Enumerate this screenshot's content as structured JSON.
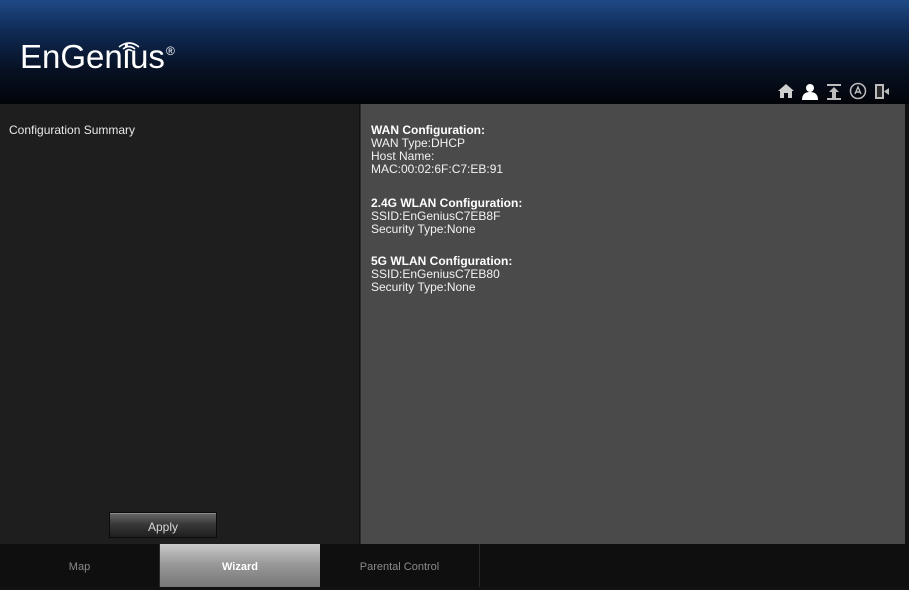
{
  "brand": {
    "name": "EnGenius",
    "reg": "®"
  },
  "toolbar": {
    "icons": [
      "home-icon",
      "user-icon",
      "upload-icon",
      "language-icon",
      "logout-icon"
    ]
  },
  "left": {
    "title": "Configuration Summary",
    "apply_label": "Apply"
  },
  "summary": {
    "wan": {
      "title": "WAN Configuration:",
      "rows": [
        "WAN Type:DHCP",
        "Host Name:",
        "MAC:00:02:6F:C7:EB:91"
      ]
    },
    "wlan24": {
      "title": "2.4G WLAN Configuration:",
      "rows": [
        "SSID:EnGeniusC7EB8F",
        "Security Type:None"
      ]
    },
    "wlan5": {
      "title": "5G WLAN Configuration:",
      "rows": [
        "SSID:EnGeniusC7EB80",
        "Security Type:None"
      ]
    }
  },
  "tabs": [
    {
      "label": "Map"
    },
    {
      "label": "Wizard"
    },
    {
      "label": "Parental Control"
    }
  ],
  "colors": {
    "header_top": "#1f4a86",
    "left_panel": "#1e1e1e",
    "right_panel": "#4a4a4a",
    "active_tab": "#a8a8a8"
  }
}
